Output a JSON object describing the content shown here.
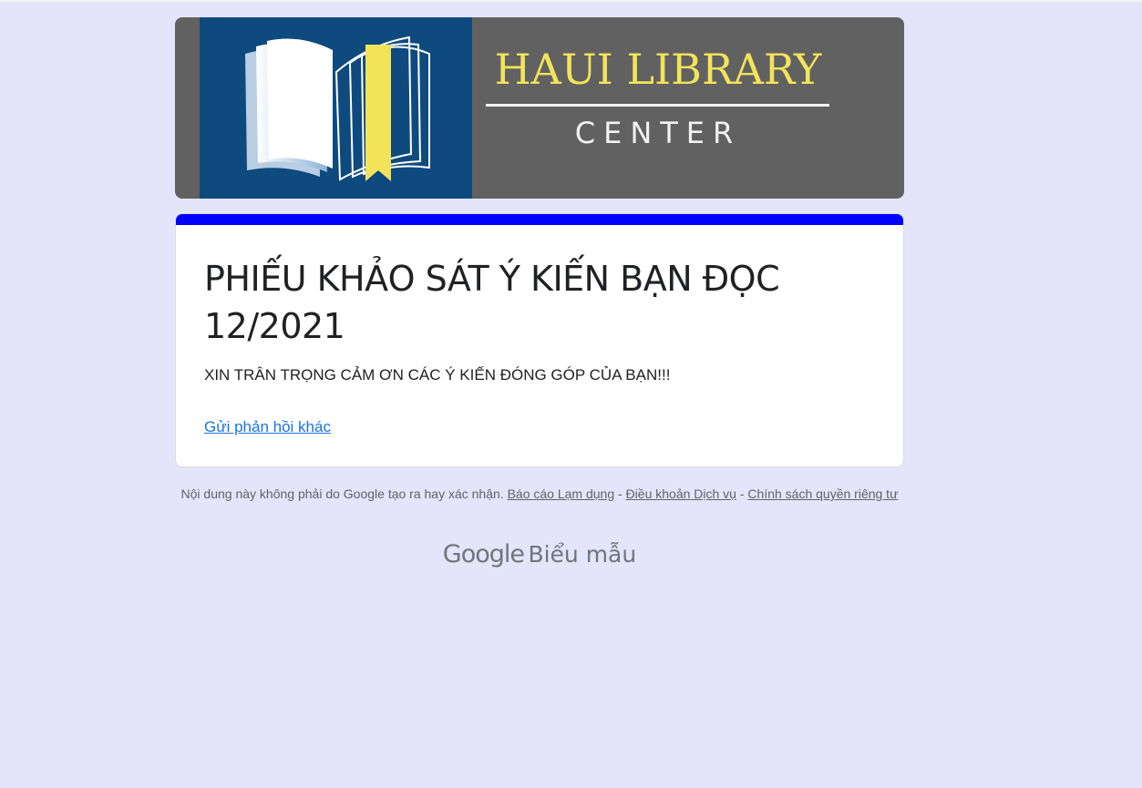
{
  "banner": {
    "title": "HAUI LIBRARY",
    "subtitle": "CENTER"
  },
  "form": {
    "title": "PHIẾU KHẢO SÁT Ý KIẾN BẠN ĐỌC 12/2021",
    "description": "XIN TRÂN TRỌNG CẢM ƠN CÁC Ý KIẾN ĐÓNG GÓP CỦA BẠN!!!",
    "submit_another_label": "Gửi phản hồi khác",
    "accent_color": "#0000ff"
  },
  "footer": {
    "disclaimer": "Nội dung này không phải do Google tạo ra hay xác nhận.",
    "report_abuse": "Báo cáo Lạm dụng",
    "separator": " - ",
    "terms": "Điều khoản Dịch vụ",
    "privacy": "Chính sách quyền riêng tư"
  },
  "brand": {
    "google": "Google",
    "forms": "Biểu mẫu"
  }
}
